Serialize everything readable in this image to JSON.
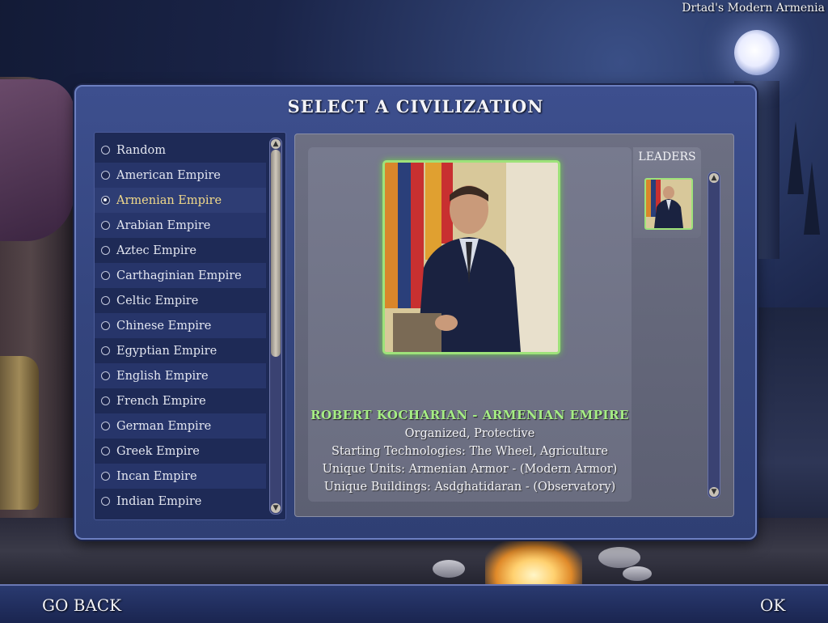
{
  "mod_title": "Drtad's Modern Armenia",
  "dialog": {
    "title": "SELECT A CIVILIZATION"
  },
  "civilizations": [
    {
      "label": "Random",
      "selected": false
    },
    {
      "label": "American Empire",
      "selected": false
    },
    {
      "label": "Armenian Empire",
      "selected": true
    },
    {
      "label": "Arabian Empire",
      "selected": false
    },
    {
      "label": "Aztec Empire",
      "selected": false
    },
    {
      "label": "Carthaginian Empire",
      "selected": false
    },
    {
      "label": "Celtic Empire",
      "selected": false
    },
    {
      "label": "Chinese Empire",
      "selected": false
    },
    {
      "label": "Egyptian Empire",
      "selected": false
    },
    {
      "label": "English Empire",
      "selected": false
    },
    {
      "label": "French Empire",
      "selected": false
    },
    {
      "label": "German Empire",
      "selected": false
    },
    {
      "label": "Greek Empire",
      "selected": false
    },
    {
      "label": "Incan Empire",
      "selected": false
    },
    {
      "label": "Indian Empire",
      "selected": false
    }
  ],
  "leaders_panel": {
    "title": "LEADERS"
  },
  "leader_info": {
    "name": "ROBERT KOCHARIAN - ARMENIAN EMPIRE",
    "traits": "Organized, Protective",
    "technologies": "Starting Technologies: The Wheel, Agriculture",
    "units": "Unique Units: Armenian Armor - (Modern Armor)",
    "buildings": "Unique Buildings: Asdghatidaran - (Observatory)"
  },
  "footer": {
    "back_label": "GO BACK",
    "ok_label": "OK"
  },
  "colors": {
    "highlight_green": "#a6ee84",
    "selected_text": "#f1d98a",
    "panel_blue": "#34457e"
  }
}
